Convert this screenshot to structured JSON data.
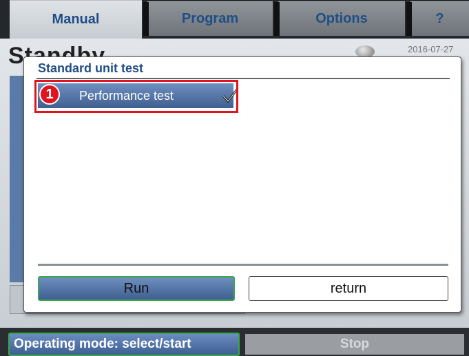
{
  "tabs": [
    {
      "label": "Manual"
    },
    {
      "label": "Program"
    },
    {
      "label": "Options"
    },
    {
      "label": "?"
    }
  ],
  "background": {
    "title": "Standby",
    "date": "2016-07-27"
  },
  "dialog": {
    "title": "Standard unit test",
    "items": [
      {
        "label": "Performance test",
        "checked": true,
        "icon": "check-icon"
      }
    ],
    "callout_number": "1",
    "run_label": "Run",
    "return_label": "return"
  },
  "footer": {
    "operating_mode": "Operating mode: select/start",
    "stop_label": "Stop"
  },
  "colors": {
    "accent_blue": "#3f5f90",
    "title_blue": "#1f4e86",
    "highlight_red": "#e0141e",
    "focus_green": "#3aa84a"
  }
}
